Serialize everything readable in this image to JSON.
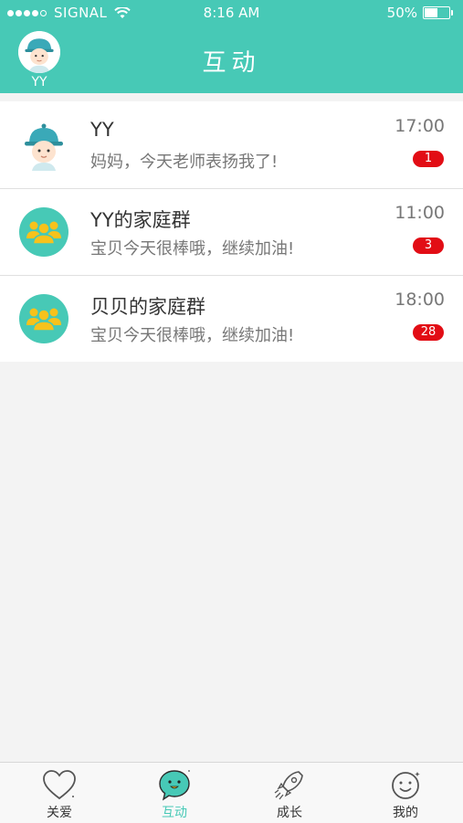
{
  "status_bar": {
    "carrier": "SIGNAL",
    "time": "8:16 AM",
    "battery": "50%",
    "battery_level": 0.5
  },
  "header": {
    "title": "互动",
    "avatar_label": "YY"
  },
  "conversations": [
    {
      "name": "YY",
      "message": "妈妈，今天老师表扬我了!",
      "time": "17:00",
      "unread": "1",
      "avatar": "child-avatar-icon"
    },
    {
      "name": "YY的家庭群",
      "message": "宝贝今天很棒哦，继续加油!",
      "time": "11:00",
      "unread": "3",
      "avatar": "group-icon"
    },
    {
      "name": "贝贝的家庭群",
      "message": "宝贝今天很棒哦，继续加油!",
      "time": "18:00",
      "unread": "28",
      "avatar": "group-icon"
    }
  ],
  "tabs": [
    {
      "label": "关爱",
      "icon": "heart-icon",
      "active": false
    },
    {
      "label": "互动",
      "icon": "chat-bubble-icon",
      "active": true
    },
    {
      "label": "成长",
      "icon": "rocket-icon",
      "active": false
    },
    {
      "label": "我的",
      "icon": "smiley-icon",
      "active": false
    }
  ],
  "colors": {
    "accent": "#47c9b6",
    "badge": "#e20d15",
    "group_avatar_bg": "#47c9b6",
    "group_figures": "#f7c21c"
  }
}
